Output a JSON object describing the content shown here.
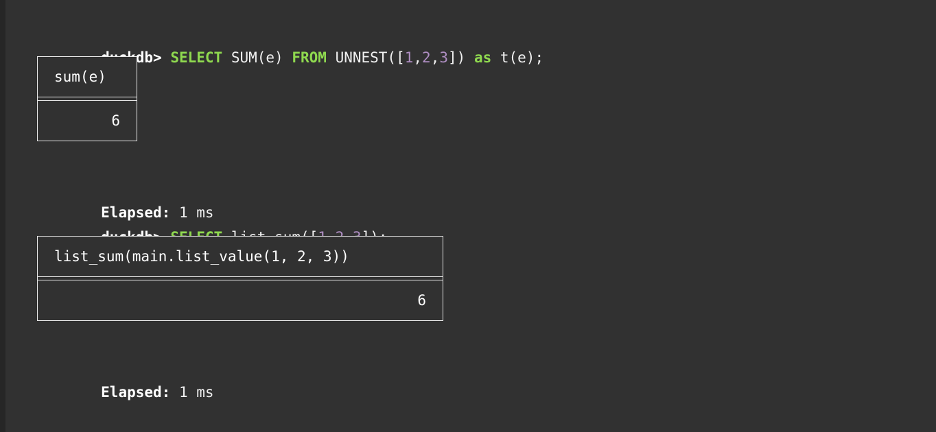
{
  "terminal": {
    "app": "duckdb-cli",
    "background_color": "#313131",
    "text_color": "#f2f2f2",
    "keyword_color": "#8fd94f",
    "number_color": "#b08fc4",
    "border_color": "#e8e8e8"
  },
  "blocks": [
    {
      "prompt": "duckdb>",
      "query_tokens": [
        {
          "text": " ",
          "type": "plain"
        },
        {
          "text": "SELECT",
          "type": "keyword"
        },
        {
          "text": " SUM(e) ",
          "type": "plain"
        },
        {
          "text": "FROM",
          "type": "keyword"
        },
        {
          "text": " UNNEST([",
          "type": "plain"
        },
        {
          "text": "1",
          "type": "number"
        },
        {
          "text": ",",
          "type": "plain"
        },
        {
          "text": "2",
          "type": "number"
        },
        {
          "text": ",",
          "type": "plain"
        },
        {
          "text": "3",
          "type": "number"
        },
        {
          "text": "]) ",
          "type": "plain"
        },
        {
          "text": "as",
          "type": "keyword"
        },
        {
          "text": " t(e);",
          "type": "plain"
        }
      ],
      "query_plain": "duckdb> SELECT SUM(e) FROM UNNEST([1,2,3]) as t(e);",
      "result": {
        "header": "sum(e)",
        "value": "6"
      },
      "elapsed_label": "Elapsed:",
      "elapsed_value": "1 ms"
    },
    {
      "prompt": "duckdb>",
      "query_tokens": [
        {
          "text": " ",
          "type": "plain"
        },
        {
          "text": "SELECT",
          "type": "keyword"
        },
        {
          "text": " list_sum([",
          "type": "plain"
        },
        {
          "text": "1",
          "type": "number"
        },
        {
          "text": ",",
          "type": "plain"
        },
        {
          "text": "2",
          "type": "number"
        },
        {
          "text": ",",
          "type": "plain"
        },
        {
          "text": "3",
          "type": "number"
        },
        {
          "text": "]);",
          "type": "plain"
        }
      ],
      "query_plain": "duckdb> SELECT list_sum([1,2,3]);",
      "result": {
        "header": "list_sum(main.list_value(1, 2, 3))",
        "value": "6"
      },
      "elapsed_label": "Elapsed:",
      "elapsed_value": "1 ms"
    }
  ]
}
